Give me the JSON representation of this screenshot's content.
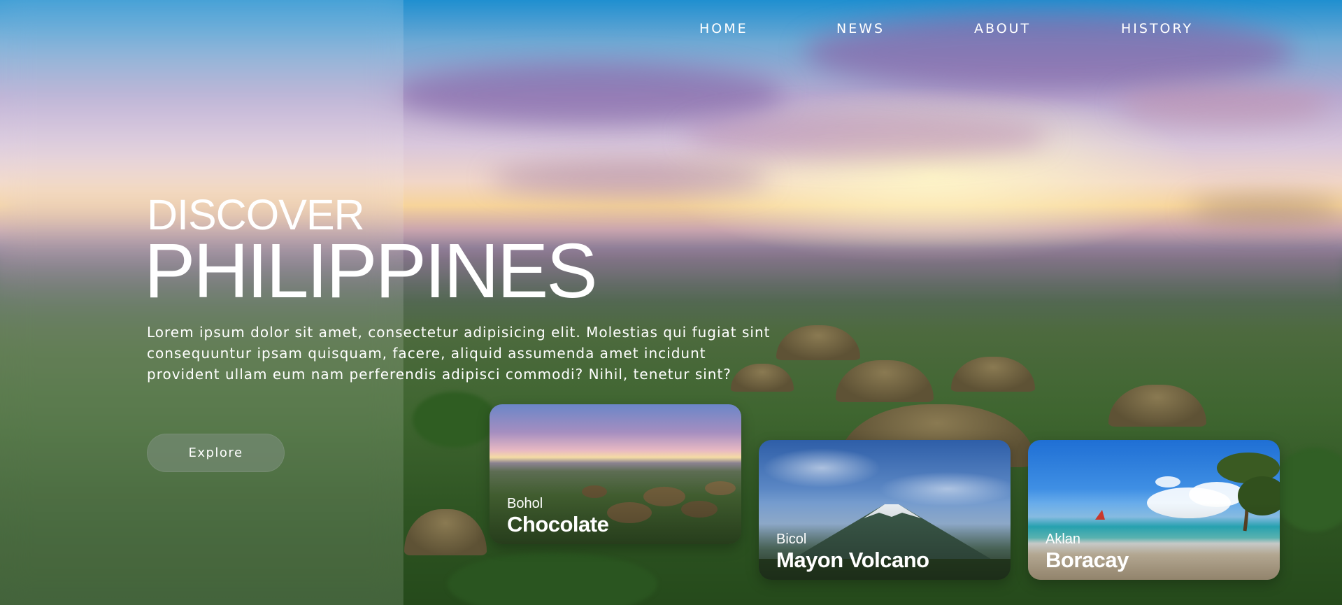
{
  "nav": {
    "items": [
      {
        "label": "HOME"
      },
      {
        "label": "NEWS"
      },
      {
        "label": "ABOUT"
      },
      {
        "label": "HISTORY"
      }
    ]
  },
  "hero": {
    "kicker": "DISCOVER",
    "title": "PHILIPPINES",
    "description": "Lorem ipsum dolor sit amet, consectetur adipisicing elit. Molestias qui fugiat sint consequuntur ipsam quisquam, facere, aliquid assumenda amet incidunt provident ullam eum nam perferendis adipisci commodi? Nihil, tenetur sint?",
    "button_label": "Explore"
  },
  "cards": [
    {
      "region": "Bohol",
      "name": "Chocolate"
    },
    {
      "region": "Bicol",
      "name": "Mayon Volcano"
    },
    {
      "region": "Aklan",
      "name": "Boracay"
    }
  ]
}
